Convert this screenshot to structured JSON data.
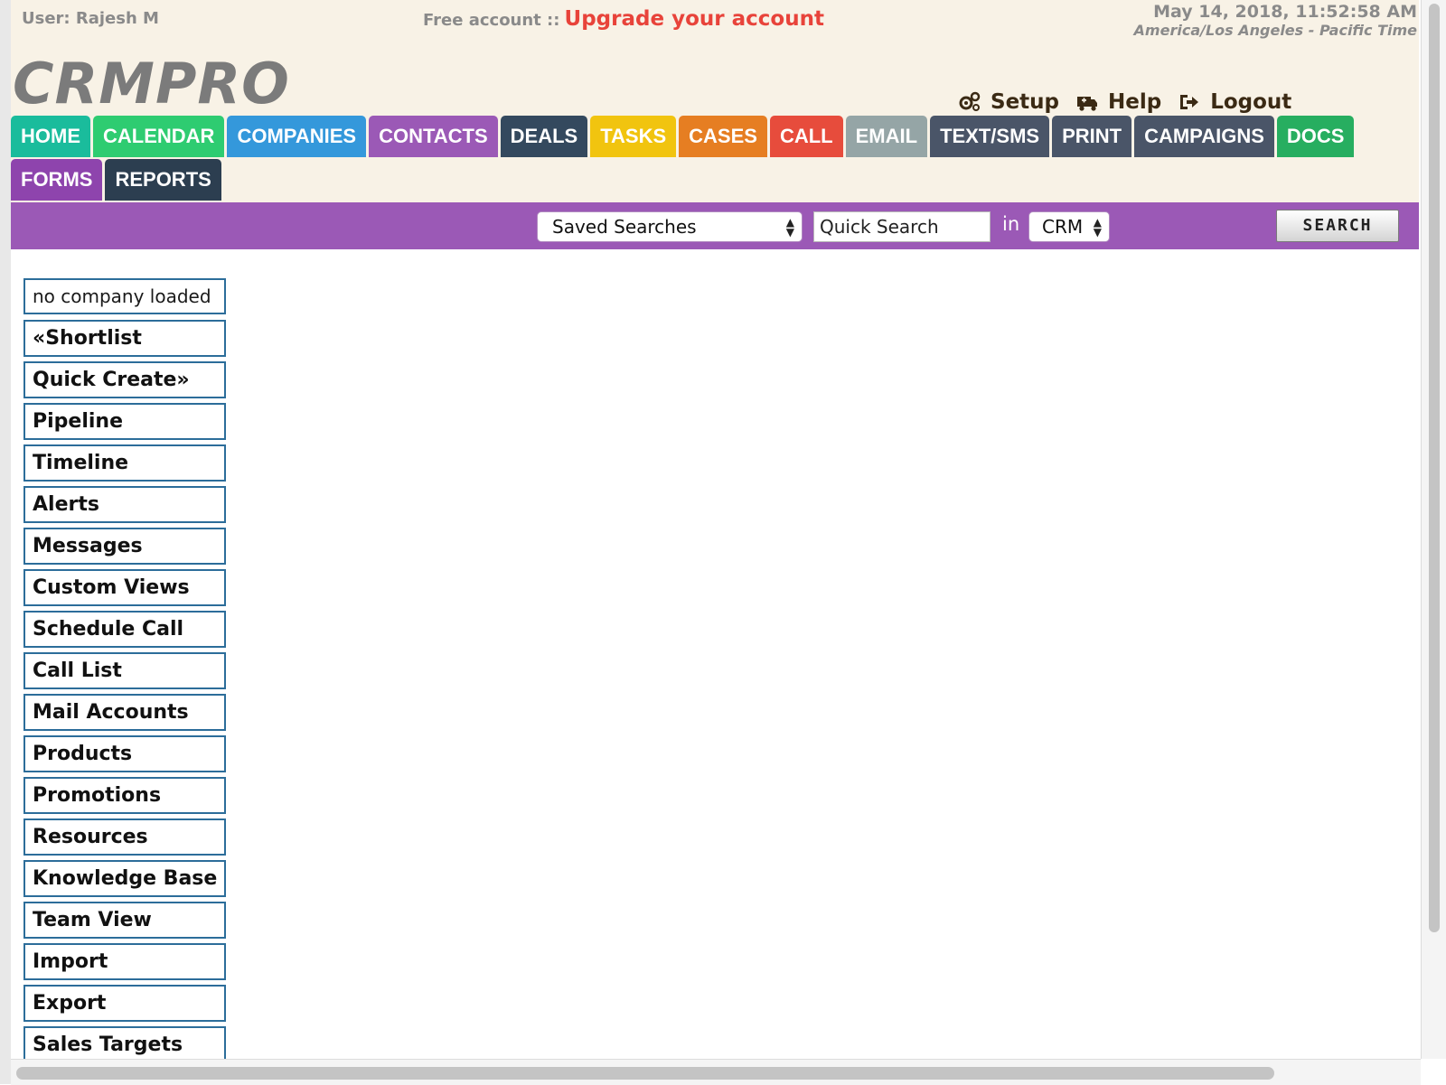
{
  "header": {
    "user_label": "User: Rajesh M",
    "account_type": "Free account ::",
    "upgrade_link": "Upgrade your account",
    "datetime": "May 14, 2018, 11:52:58 AM",
    "timezone": "America/Los Angeles - Pacific Time",
    "logo_text": "CRMPRO",
    "top_links": [
      {
        "label": "Setup",
        "icon": "gears-icon"
      },
      {
        "label": "Help",
        "icon": "ambulance-icon"
      },
      {
        "label": "Logout",
        "icon": "sign-out-icon"
      }
    ]
  },
  "nav": {
    "tabs": [
      {
        "label": "HOME",
        "color": "#1abc9c"
      },
      {
        "label": "CALENDAR",
        "color": "#2ecc71"
      },
      {
        "label": "COMPANIES",
        "color": "#3498db"
      },
      {
        "label": "CONTACTS",
        "color": "#9b59b6"
      },
      {
        "label": "DEALS",
        "color": "#34495e"
      },
      {
        "label": "TASKS",
        "color": "#f1c40f"
      },
      {
        "label": "CASES",
        "color": "#e67e22"
      },
      {
        "label": "CALL",
        "color": "#e74c3c"
      },
      {
        "label": "EMAIL",
        "color": "#95a5a6"
      },
      {
        "label": "TEXT/SMS",
        "color": "#4a5568"
      },
      {
        "label": "PRINT",
        "color": "#4a5568"
      },
      {
        "label": "CAMPAIGNS",
        "color": "#4a5568"
      },
      {
        "label": "DOCS",
        "color": "#27ae60"
      },
      {
        "label": "FORMS",
        "color": "#8e44ad"
      },
      {
        "label": "REPORTS",
        "color": "#2c3e50"
      }
    ]
  },
  "search": {
    "saved_searches": "Saved Searches",
    "quick_search_placeholder": "Quick Search",
    "in_label": "in",
    "scope": "CRM",
    "button": "SEARCH"
  },
  "sidebar": {
    "company_status": "no company loaded",
    "items": [
      "«Shortlist",
      "Quick Create»",
      "Pipeline",
      "Timeline",
      "Alerts",
      "Messages",
      "Custom Views",
      "Schedule Call",
      "Call List",
      "Mail Accounts",
      "Products",
      "Promotions",
      "Resources",
      "Knowledge Base",
      "Team View",
      "Import",
      "Export",
      "Sales Targets"
    ]
  },
  "colors": {
    "header_bg": "#f8f2e6",
    "search_bar": "#9b59b6",
    "upgrade": "#e8433a",
    "sidebar_border": "#2c6d9a"
  }
}
